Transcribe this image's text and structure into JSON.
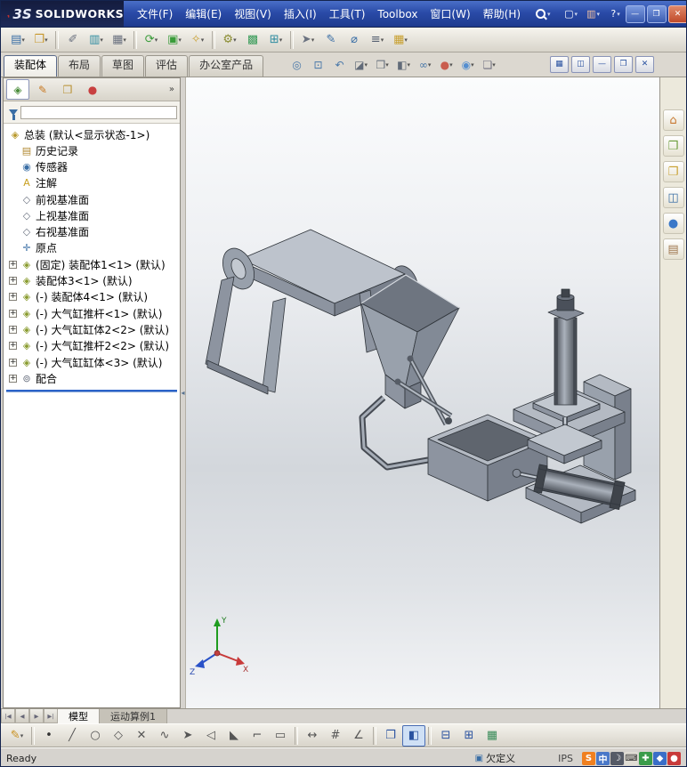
{
  "title_bar": {
    "logo_3s": "3S",
    "logo_text": "SOLIDWORKS",
    "menus": [
      {
        "name": "menu-file",
        "label": "文件(F)"
      },
      {
        "name": "menu-edit",
        "label": "编辑(E)"
      },
      {
        "name": "menu-view",
        "label": "视图(V)"
      },
      {
        "name": "menu-insert",
        "label": "插入(I)"
      },
      {
        "name": "menu-tools",
        "label": "工具(T)"
      },
      {
        "name": "menu-toolbox",
        "label": "Toolbox"
      },
      {
        "name": "menu-window",
        "label": "窗口(W)"
      },
      {
        "name": "menu-help",
        "label": "帮助(H)"
      }
    ],
    "quick_icons": [
      {
        "name": "new-document-icon",
        "glyph": "▢",
        "color": "#ffffff",
        "dd": true
      },
      {
        "name": "toolbox-settings-icon",
        "glyph": "▥",
        "color": "#f0c0a0",
        "dd": true
      },
      {
        "name": "help-icon",
        "glyph": "?",
        "color": "#ffffff",
        "dd": true
      }
    ],
    "window_buttons": [
      {
        "name": "minimize-button",
        "glyph": "—"
      },
      {
        "name": "maximize-button",
        "glyph": "❐"
      },
      {
        "name": "close-button",
        "glyph": "✕"
      }
    ]
  },
  "standard_toolbar": [
    {
      "name": "new-from-template-icon",
      "glyph": "▤",
      "color": "#3a6ea5",
      "dd": true
    },
    {
      "name": "open-document-icon",
      "glyph": "❒",
      "color": "#c8972c",
      "dd": true
    },
    {
      "sep": true
    },
    {
      "name": "paperclip-icon",
      "glyph": "✐",
      "color": "#6b7280"
    },
    {
      "name": "bom-columns-icon",
      "glyph": "▥",
      "color": "#2e8ca0",
      "dd": true
    },
    {
      "name": "print-icon",
      "glyph": "▦",
      "color": "#6b7280",
      "dd": true
    },
    {
      "sep": true
    },
    {
      "name": "rebuild-icon",
      "glyph": "⟳",
      "color": "#3a9c3a",
      "dd": true
    },
    {
      "name": "rebuild-check-icon",
      "glyph": "▣",
      "color": "#3a9c3a",
      "dd": true
    },
    {
      "name": "spec-flask-icon",
      "glyph": "✧",
      "color": "#c8a030",
      "dd": true
    },
    {
      "sep": true
    },
    {
      "name": "gears-icon",
      "glyph": "⚙",
      "color": "#8a8c30",
      "dd": true
    },
    {
      "name": "color-grid-icon",
      "glyph": "▩",
      "color": "#3a9c5a"
    },
    {
      "name": "export-icon",
      "glyph": "⊞",
      "color": "#2e8ca0",
      "dd": true
    },
    {
      "sep": true
    },
    {
      "name": "select-arrow-icon",
      "glyph": "➤",
      "color": "#6b7280",
      "dd": true
    },
    {
      "name": "sketch-pencil-icon",
      "glyph": "✎",
      "color": "#3a6ea5"
    },
    {
      "name": "measure-icon",
      "glyph": "⌀",
      "color": "#3a6ea5"
    },
    {
      "name": "options-icon",
      "glyph": "≡",
      "color": "#556070",
      "dd": true
    },
    {
      "name": "design-table-icon",
      "glyph": "▦",
      "color": "#c8a030",
      "dd": true
    }
  ],
  "command_tabs": [
    {
      "name": "tab-assembly",
      "label": "装配体",
      "active": true
    },
    {
      "name": "tab-layout",
      "label": "布局"
    },
    {
      "name": "tab-sketch",
      "label": "草图"
    },
    {
      "name": "tab-evaluate",
      "label": "评估"
    },
    {
      "name": "tab-office",
      "label": "办公室产品"
    }
  ],
  "view_toolbar": [
    {
      "name": "zoom-fit-icon",
      "glyph": "◎",
      "color": "#3a6ea5"
    },
    {
      "name": "zoom-area-icon",
      "glyph": "⊡",
      "color": "#3a6ea5"
    },
    {
      "name": "previous-view-icon",
      "glyph": "↶",
      "color": "#3a6ea5"
    },
    {
      "name": "section-view-icon",
      "glyph": "◪",
      "color": "#556070",
      "dd": true
    },
    {
      "name": "view-orientation-icon",
      "glyph": "❒",
      "color": "#556070",
      "dd": true
    },
    {
      "name": "display-style-icon",
      "glyph": "◧",
      "color": "#556070",
      "dd": true
    },
    {
      "name": "hide-show-items-icon",
      "glyph": "∞",
      "color": "#3a6ea5",
      "dd": true
    },
    {
      "name": "edit-appearance-icon",
      "glyph": "●",
      "color": "#c85040",
      "dd": true
    },
    {
      "name": "apply-scene-icon",
      "glyph": "◉",
      "color": "#4888d0",
      "dd": true
    },
    {
      "name": "view-settings-icon",
      "glyph": "❏",
      "color": "#667",
      "dd": true
    }
  ],
  "child_window_buttons": [
    {
      "name": "viewport-pane-icon",
      "glyph": "▦",
      "color": "#2a52a0"
    },
    {
      "name": "viewport-split-icon",
      "glyph": "◫",
      "color": "#2a52a0"
    },
    {
      "name": "child-minimize-button",
      "glyph": "—",
      "color": "#2a52a0"
    },
    {
      "name": "child-restore-button",
      "glyph": "❐",
      "color": "#2a52a0"
    },
    {
      "name": "child-close-button",
      "glyph": "✕",
      "color": "#2a52a0"
    }
  ],
  "feature_panel": {
    "tabs": [
      {
        "name": "featuremanager-tab",
        "glyph": "◈",
        "color": "#4a8c3a",
        "active": true
      },
      {
        "name": "propertymanager-tab",
        "glyph": "✎",
        "color": "#c87820"
      },
      {
        "name": "configurationmanager-tab",
        "glyph": "❒",
        "color": "#b89030"
      },
      {
        "name": "displaymanager-tab",
        "glyph": "●",
        "color": "#c84040"
      }
    ],
    "chevron": "»",
    "root_glyph": "◈",
    "root_label": "总装 (默认<显示状态-1>)",
    "items": [
      {
        "name": "tree-item-history",
        "label": "历史记录",
        "glyph": "▤",
        "color": "#b08830"
      },
      {
        "name": "tree-item-sensors",
        "label": "传感器",
        "glyph": "◉",
        "color": "#3a6ea5"
      },
      {
        "name": "tree-item-annotations",
        "label": "注解",
        "glyph": "A",
        "color": "#c8a020"
      },
      {
        "name": "tree-item-front-plane",
        "label": "前视基准面",
        "glyph": "◇",
        "color": "#6b7280"
      },
      {
        "name": "tree-item-top-plane",
        "label": "上视基准面",
        "glyph": "◇",
        "color": "#6b7280"
      },
      {
        "name": "tree-item-right-plane",
        "label": "右视基准面",
        "glyph": "◇",
        "color": "#6b7280"
      },
      {
        "name": "tree-item-origin",
        "label": "原点",
        "glyph": "✛",
        "color": "#3a6ea5"
      },
      {
        "name": "tree-item-assembly1",
        "label": "(固定) 装配体1<1> (默认)",
        "glyph": "◈",
        "color": "#8a9c30",
        "exp": "+"
      },
      {
        "name": "tree-item-assembly3",
        "label": "装配体3<1> (默认)",
        "glyph": "◈",
        "color": "#8a9c30",
        "exp": "+"
      },
      {
        "name": "tree-item-assembly4",
        "label": "(-) 装配体4<1> (默认)",
        "glyph": "◈",
        "color": "#8a9c30",
        "exp": "+"
      },
      {
        "name": "tree-item-cylinder-rod1",
        "label": "(-) 大气缸推杆<1> (默认)",
        "glyph": "◈",
        "color": "#8a9c30",
        "exp": "+"
      },
      {
        "name": "tree-item-cylinder-body2",
        "label": "(-) 大气缸缸体2<2> (默认)",
        "glyph": "◈",
        "color": "#8a9c30",
        "exp": "+"
      },
      {
        "name": "tree-item-cylinder-rod2",
        "label": "(-) 大气缸推杆2<2> (默认)",
        "glyph": "◈",
        "color": "#8a9c30",
        "exp": "+"
      },
      {
        "name": "tree-item-cylinder-body3",
        "label": "(-) 大气缸缸体<3> (默认)",
        "glyph": "◈",
        "color": "#8a9c30",
        "exp": "+"
      },
      {
        "name": "tree-item-mates",
        "label": "配合",
        "glyph": "⊚",
        "color": "#6b7280",
        "exp": "+"
      }
    ]
  },
  "task_pane": [
    {
      "name": "home-icon",
      "glyph": "⌂",
      "color": "#c87830"
    },
    {
      "name": "design-library-icon",
      "glyph": "❒",
      "color": "#6a9c3a"
    },
    {
      "name": "file-explorer-icon",
      "glyph": "❐",
      "color": "#c8a030"
    },
    {
      "name": "view-palette-icon",
      "glyph": "◫",
      "color": "#3a6ea5"
    },
    {
      "name": "appearances-icon",
      "glyph": "●",
      "color": "#3a78c8"
    },
    {
      "name": "custom-properties-icon",
      "glyph": "▤",
      "color": "#a07850"
    }
  ],
  "viewport": {
    "triad": {
      "x": "X",
      "y": "Y",
      "z": "Z"
    }
  },
  "bottom_bar": {
    "nav": [
      {
        "name": "first-tab-button",
        "glyph": "|◀"
      },
      {
        "name": "prev-tab-button",
        "glyph": "◀"
      },
      {
        "name": "next-tab-button",
        "glyph": "▶"
      },
      {
        "name": "last-tab-button",
        "glyph": "▶|"
      }
    ],
    "tabs": [
      {
        "name": "model-tab",
        "label": "模型",
        "active": true
      },
      {
        "name": "motion-study-tab",
        "label": "运动算例1"
      }
    ]
  },
  "sketch_toolbar": [
    {
      "name": "sketch-icon",
      "glyph": "✎",
      "color": "#c89020",
      "dd": true
    },
    {
      "sep": true
    },
    {
      "name": "point-tool-icon",
      "glyph": "•",
      "color": "#333333"
    },
    {
      "name": "line-tool-icon",
      "glyph": "╱",
      "color": "#555555"
    },
    {
      "name": "circle-tool-icon",
      "glyph": "○",
      "color": "#555555"
    },
    {
      "name": "polygon-tool-icon",
      "glyph": "◇",
      "color": "#555555"
    },
    {
      "name": "trim-tool-icon",
      "glyph": "✕",
      "color": "#555555"
    },
    {
      "name": "spline-tool-icon",
      "glyph": "∿",
      "color": "#555555"
    },
    {
      "name": "arrow-tool-icon",
      "glyph": "➤",
      "color": "#555555"
    },
    {
      "name": "mirror-tool-icon",
      "glyph": "◁",
      "color": "#555555"
    },
    {
      "name": "chamfer-tool-icon",
      "glyph": "◣",
      "color": "#555555"
    },
    {
      "name": "offset-tool-icon",
      "glyph": "⌐",
      "color": "#555555"
    },
    {
      "name": "construction-rect-icon",
      "glyph": "▭",
      "color": "#555555"
    },
    {
      "sep": true
    },
    {
      "name": "move-tool-icon",
      "glyph": "↔",
      "color": "#555555"
    },
    {
      "name": "grid-icon",
      "glyph": "#",
      "color": "#555555"
    },
    {
      "name": "angle-tool-icon",
      "glyph": "∠",
      "color": "#555555"
    },
    {
      "sep": true
    },
    {
      "name": "viewport-window-icon",
      "glyph": "❐",
      "color": "#2a52a0"
    },
    {
      "name": "shaded-view-icon",
      "glyph": "◧",
      "color": "#2a52a0",
      "active": true
    },
    {
      "sep": true
    },
    {
      "name": "split-horizontal-icon",
      "glyph": "⊟",
      "color": "#2a52a0"
    },
    {
      "name": "split-vertical-icon",
      "glyph": "⊞",
      "color": "#2a52a0"
    },
    {
      "name": "sheet-table-icon",
      "glyph": "▦",
      "color": "#3a8c5a"
    }
  ],
  "status_bar": {
    "ready": "Ready",
    "constraint_icon": "▣",
    "constraint": "欠定义",
    "units": "IPS",
    "ime_icons": [
      {
        "name": "sogou-icon",
        "glyph": "S",
        "color": "#ffffff",
        "bg": "#f08020"
      },
      {
        "name": "ime-language-icon",
        "glyph": "中",
        "color": "#ffffff",
        "bg": "#4a78c8"
      },
      {
        "name": "ime-mode-icon",
        "glyph": "☽",
        "color": "#ffffff",
        "bg": "#555a66"
      },
      {
        "name": "ime-keyboard-icon",
        "glyph": "⌨",
        "color": "#333333",
        "bg": "#e0ddd4"
      },
      {
        "name": "tray-plus-icon",
        "glyph": "✚",
        "color": "#ffffff",
        "bg": "#3a9c4a"
      },
      {
        "name": "tray-diamond-icon",
        "glyph": "◆",
        "color": "#ffffff",
        "bg": "#3a6ec8"
      },
      {
        "name": "tray-dot-icon",
        "glyph": "●",
        "color": "#ffffff",
        "bg": "#c83a3a"
      }
    ]
  },
  "colors": {
    "titlebar_blue": "#2a4ba8",
    "rollback_blue": "#2a62c8",
    "model_gray": "#8d94a0"
  }
}
